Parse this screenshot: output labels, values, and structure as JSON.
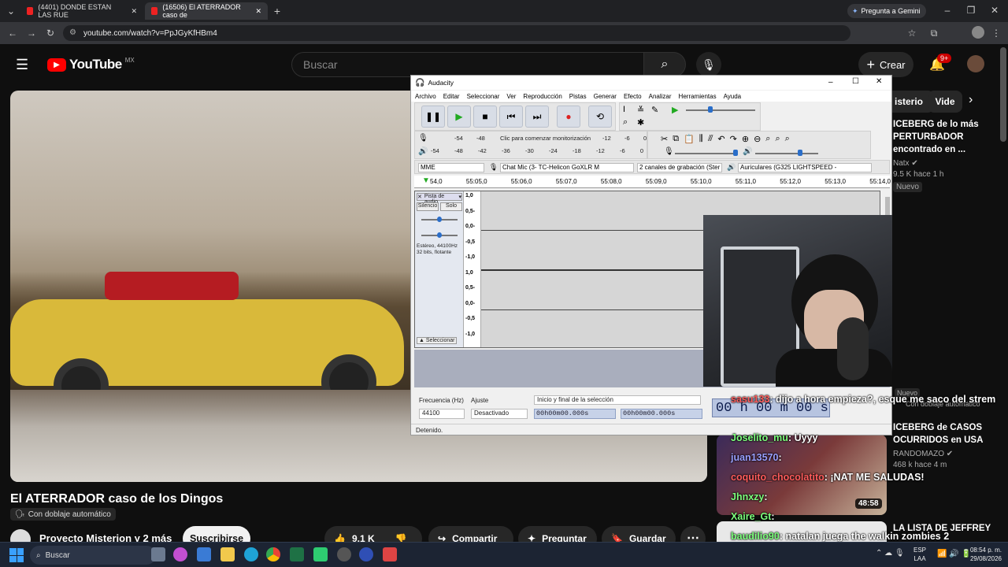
{
  "browser": {
    "tabs": [
      {
        "label": "(4401) DONDE ESTAN LAS RUE"
      },
      {
        "label": "(16506) El ATERRADOR caso de"
      }
    ],
    "gemini": "Pregunta a Gemini",
    "url": "youtube.com/watch?v=PpJGyKfHBm4"
  },
  "youtube": {
    "logo": "YouTube",
    "region": "MX",
    "search_placeholder": "Buscar",
    "create": "Crear",
    "notif_badge": "9+",
    "video_title": "El ATERRADOR caso de los Dingos",
    "dub_label": "Con doblaje automático",
    "channel": "Proyecto Misterion y 2 más",
    "subscribe": "Suscribirse",
    "likes": "9,1 K",
    "share": "Compartir",
    "ask": "Preguntar",
    "save": "Guardar",
    "chips": [
      "isterio",
      "Vide"
    ],
    "sidebar": [
      {
        "title": "ICEBERG de lo más PERTURBADOR encontrado en ...",
        "channel": "Natx",
        "meta": "9.5 K  hace 1 h",
        "badge": "Nuevo"
      },
      {
        "title": "ICEBERG de CASOS OCURRIDOS en USA",
        "channel": "RANDOMAZO",
        "meta": "468 k  hace 4 m",
        "duration": "48:58"
      },
      {
        "title": "LA LISTA DE JEFFREY",
        "channel": ""
      }
    ],
    "new_badge2": "Nuevo",
    "auto_dub2": "Con doblaje automático"
  },
  "audacity": {
    "title": "Audacity",
    "menu": [
      "Archivo",
      "Editar",
      "Seleccionar",
      "Ver",
      "Reproducción",
      "Pistas",
      "Generar",
      "Efecto",
      "Analizar",
      "Herramientas",
      "Ayuda"
    ],
    "meter_rec": [
      "-54",
      "-48",
      "Clic para comenzar monitorización",
      "-12",
      "-6",
      "0"
    ],
    "meter_play": [
      "-54",
      "-48",
      "-42",
      "-36",
      "-30",
      "-24",
      "-18",
      "-12",
      "-6",
      "0"
    ],
    "host": "MME",
    "mic": "Chat Mic (3- TC-Helicon GoXLR M",
    "channels": "2 canales de grabación (Ster",
    "out": "Auriculares (G325 LIGHTSPEED -",
    "ruler": [
      "54,0",
      "55:05,0",
      "55:06,0",
      "55:07,0",
      "55:08,0",
      "55:09,0",
      "55:10,0",
      "55:11,0",
      "55:12,0",
      "55:13,0",
      "55:14,0"
    ],
    "track": {
      "name": "Pista de audio",
      "mute": "Silencio",
      "solo": "Solo",
      "info1": "Estéreo, 44100Hz",
      "info2": "32 bits, flotante",
      "select": "Seleccionar",
      "scale": [
        "1,0",
        "0,5-",
        "0,0-",
        "-0,5",
        "-1,0",
        "1,0",
        "0,5-",
        "0,0-",
        "-0,5",
        "-1,0"
      ]
    },
    "rate_label": "Frecuencia (Hz)",
    "rate": "44100",
    "snap_label": "Ajuste",
    "snap": "Desactivado",
    "sel_label": "Inicio y final de la selección",
    "sel_start": "00h00m00.000s",
    "sel_end": "00h00m00.000s",
    "time": "00 h 00 m 00 s",
    "status": "Detenido."
  },
  "chat": [
    {
      "user": "sasu133",
      "msg": ": dijo a hora empieza?, esque me saco del strem"
    },
    {
      "user": "Joselito_mu",
      "msg": ": Uyyy"
    },
    {
      "user": "juan13570",
      "msg": ":"
    },
    {
      "user": "coquito_chocolatito",
      "msg": ": ¡NAT ME SALUDAS!"
    },
    {
      "user": "Jhnxzy",
      "msg": ":"
    },
    {
      "user": "Xaire_Gt",
      "msg": ":"
    },
    {
      "user": "baudilio90",
      "msg": ": natalan juega the walkin zombies 2"
    }
  ],
  "taskbar": {
    "search": "Buscar",
    "lang1": "ESP",
    "lang2": "LAA",
    "time": "08:54 p. m.",
    "date": "29/08/2026"
  }
}
